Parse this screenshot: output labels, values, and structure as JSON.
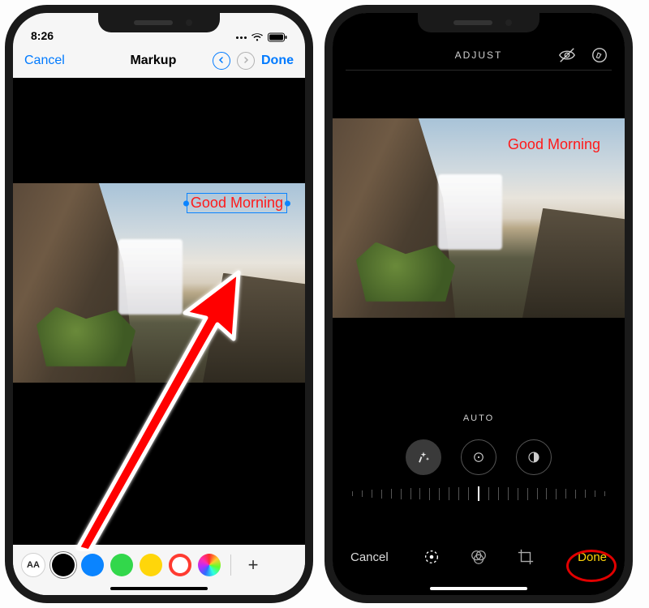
{
  "left": {
    "status": {
      "time": "8:26"
    },
    "nav": {
      "cancel": "Cancel",
      "title": "Markup",
      "done": "Done"
    },
    "text_overlay": "Good Morning",
    "toolbar": {
      "text_style": "AA",
      "colors": [
        {
          "name": "black",
          "hex": "#000000",
          "selected": true
        },
        {
          "name": "blue",
          "hex": "#0a84ff"
        },
        {
          "name": "green",
          "hex": "#32d74b"
        },
        {
          "name": "yellow",
          "hex": "#ffd60a"
        },
        {
          "name": "red",
          "hex": "#ff3b30",
          "ring": true
        },
        {
          "name": "rainbow",
          "hex": "rainbow"
        }
      ],
      "add": "+"
    }
  },
  "right": {
    "top": {
      "label": "ADJUST"
    },
    "text_overlay": "Good Morning",
    "auto_label": "AUTO",
    "dials": [
      {
        "name": "auto-wand",
        "active": true
      },
      {
        "name": "exposure"
      },
      {
        "name": "brilliance"
      }
    ],
    "bottom": {
      "cancel": "Cancel",
      "done": "Done",
      "modes": [
        {
          "name": "adjust",
          "active": true
        },
        {
          "name": "filters"
        },
        {
          "name": "crop"
        }
      ]
    }
  }
}
